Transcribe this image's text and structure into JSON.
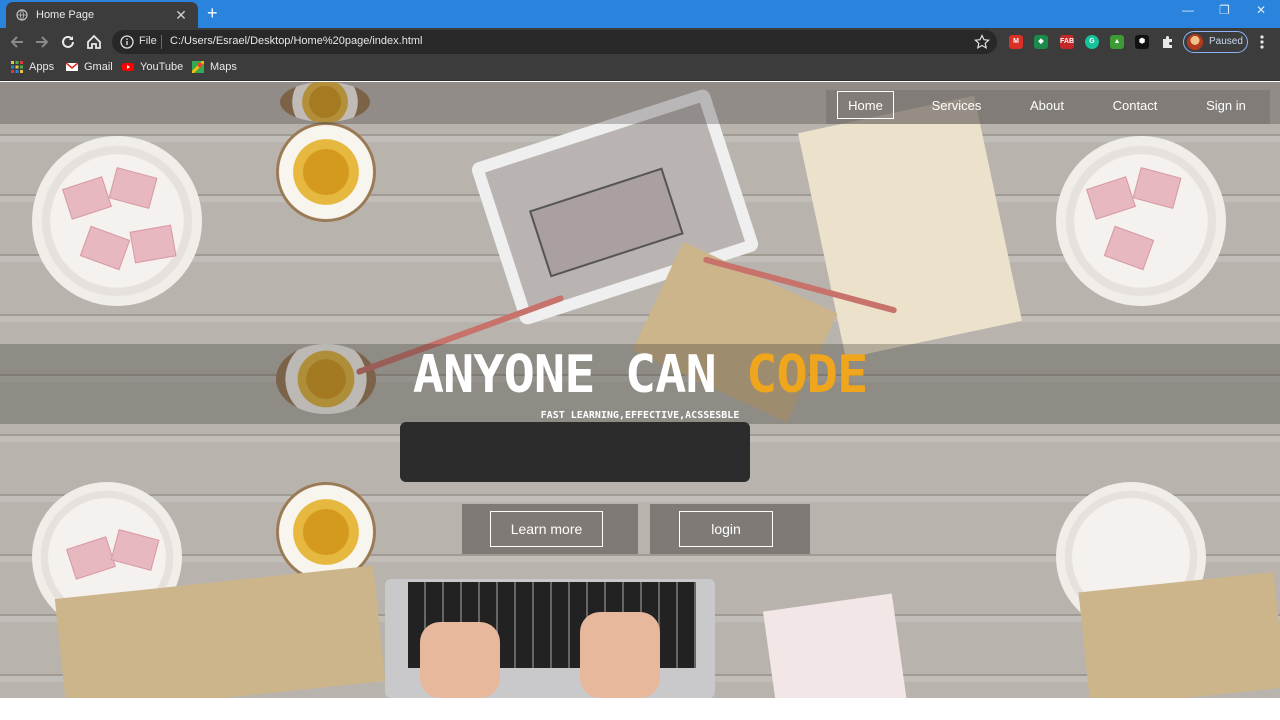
{
  "browser": {
    "tab_title": "Home Page",
    "tab_close": "✕",
    "new_tab": "+",
    "window_controls": [
      "—",
      "❐",
      "✕"
    ],
    "omnibox_scheme": "File",
    "url": "C:/Users/Esrael/Desktop/Home%20page/index.html",
    "profile_status": "Paused",
    "extensions": [
      {
        "name": "M",
        "color": "#d93025"
      },
      {
        "name": "◆",
        "color": "#1b8a4b"
      },
      {
        "name": "FAB",
        "color": "#c62828"
      },
      {
        "name": "G",
        "color": "#15c39a"
      },
      {
        "name": "▲",
        "color": "#3d9b35"
      },
      {
        "name": "⬢",
        "color": "#111111"
      }
    ],
    "bookmarks": [
      {
        "label": "Apps",
        "icon": "apps-grid-icon"
      },
      {
        "label": "Gmail",
        "icon": "gmail-icon"
      },
      {
        "label": "YouTube",
        "icon": "youtube-icon"
      },
      {
        "label": "Maps",
        "icon": "maps-icon"
      }
    ]
  },
  "site": {
    "nav": [
      "Home",
      "Services",
      "About",
      "Contact",
      "Sign in"
    ],
    "active_nav": "Home",
    "hero": {
      "title_part1": "ANYONE CAN ",
      "title_part2": "CODE",
      "subtitle": "FAST LEARNING,EFFECTIVE,ACSSESBLE"
    },
    "buttons": {
      "learn_more": "Learn more",
      "login": "login"
    },
    "colors": {
      "accent": "#f0a61c",
      "text": "#ffffff"
    }
  }
}
